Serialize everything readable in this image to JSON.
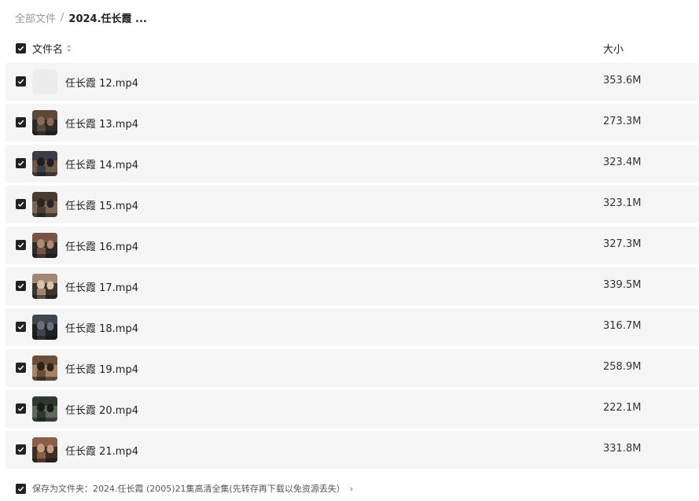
{
  "breadcrumb": {
    "root": "全部文件",
    "separator": "/",
    "current": "2024.任长霞 ..."
  },
  "table": {
    "select_all_checked": true,
    "col_name": "文件名",
    "col_size": "大小"
  },
  "files": [
    {
      "name": "任长霞 12.mp4",
      "size": "353.6M",
      "checked": true,
      "thumb": "blank"
    },
    {
      "name": "任长霞 13.mp4",
      "size": "273.3M",
      "checked": true,
      "thumb": "video-frame"
    },
    {
      "name": "任长霞 14.mp4",
      "size": "323.4M",
      "checked": true,
      "thumb": "video-frame"
    },
    {
      "name": "任长霞 15.mp4",
      "size": "323.1M",
      "checked": true,
      "thumb": "video-frame"
    },
    {
      "name": "任长霞 16.mp4",
      "size": "327.3M",
      "checked": true,
      "thumb": "video-frame"
    },
    {
      "name": "任长霞 17.mp4",
      "size": "339.5M",
      "checked": true,
      "thumb": "video-frame"
    },
    {
      "name": "任长霞 18.mp4",
      "size": "316.7M",
      "checked": true,
      "thumb": "video-frame"
    },
    {
      "name": "任长霞 19.mp4",
      "size": "258.9M",
      "checked": true,
      "thumb": "video-frame"
    },
    {
      "name": "任长霞 20.mp4",
      "size": "222.1M",
      "checked": true,
      "thumb": "video-frame"
    },
    {
      "name": "任长霞 21.mp4",
      "size": "331.8M",
      "checked": true,
      "thumb": "video-frame"
    }
  ],
  "footer": {
    "checked": true,
    "save_label": "保存为文件夹：2024.任长霞 (2005)21集高清全集(先转存再下载以免资源丢失）",
    "arrow": "›"
  },
  "colors": {
    "row_bg": "#f5f5f5",
    "checkbox": "#222222",
    "muted_text": "#999999"
  }
}
